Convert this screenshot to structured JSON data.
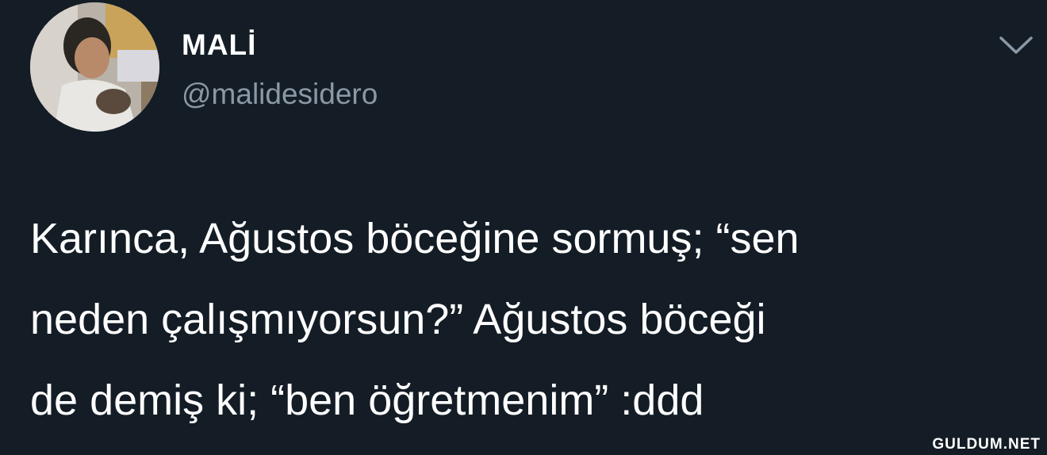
{
  "author": {
    "display_name": "MALİ",
    "handle": "@malidesidero",
    "avatar_icon": "profile-photo"
  },
  "menu": {
    "icon": "chevron-down-icon"
  },
  "tweet": {
    "lines": [
      "Karınca, Ağustos böceğine sormuş; “sen",
      "neden çalışmıyorsun?” Ağustos böceği",
      "de demiş ki; “ben öğretmenim” :ddd"
    ]
  },
  "watermark": "GULDUM.NET",
  "colors": {
    "background": "#141d26",
    "text": "#ffffff",
    "secondary_text": "#8b98a5"
  }
}
